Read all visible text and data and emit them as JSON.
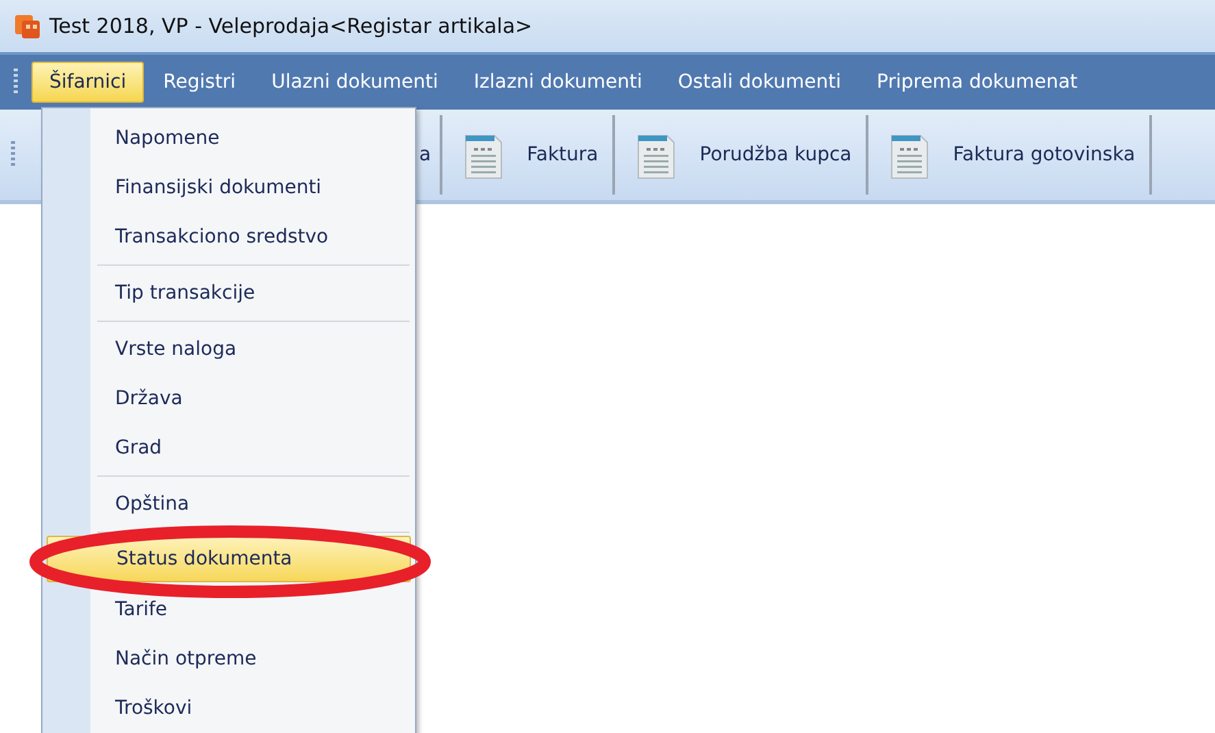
{
  "window": {
    "title": "Test 2018, VP - Veleprodaja<Registar artikala>"
  },
  "menu_bar": [
    {
      "label": "Šifarnici",
      "selected": true
    },
    {
      "label": "Registri",
      "selected": false
    },
    {
      "label": "Ulazni dokumenti",
      "selected": false
    },
    {
      "label": "Izlazni dokumenti",
      "selected": false
    },
    {
      "label": "Ostali dokumenti",
      "selected": false
    },
    {
      "label": "Priprema dokumenat",
      "selected": false
    }
  ],
  "toolbar": [
    {
      "label": "a",
      "icon": false
    },
    {
      "label": "Faktura",
      "icon": true
    },
    {
      "label": "Porudžba kupca",
      "icon": true
    },
    {
      "label": "Faktura gotovinska",
      "icon": true
    }
  ],
  "dropdown": [
    {
      "kind": "item",
      "label": "Napomene",
      "selected": false
    },
    {
      "kind": "item",
      "label": "Finansijski dokumenti",
      "selected": false
    },
    {
      "kind": "item",
      "label": "Transakciono sredstvo",
      "selected": false
    },
    {
      "kind": "separator"
    },
    {
      "kind": "item",
      "label": "Tip transakcije",
      "selected": false
    },
    {
      "kind": "separator"
    },
    {
      "kind": "item",
      "label": "Vrste naloga",
      "selected": false
    },
    {
      "kind": "item",
      "label": "Država",
      "selected": false
    },
    {
      "kind": "item",
      "label": "Grad",
      "selected": false
    },
    {
      "kind": "separator"
    },
    {
      "kind": "item",
      "label": "Opština",
      "selected": false
    },
    {
      "kind": "separator"
    },
    {
      "kind": "item",
      "label": "Status dokumenta",
      "selected": true
    },
    {
      "kind": "item",
      "label": "Tarife",
      "selected": false
    },
    {
      "kind": "item",
      "label": "Način otpreme",
      "selected": false
    },
    {
      "kind": "item",
      "label": "Troškovi",
      "selected": false
    }
  ],
  "annotation": {
    "kind": "ellipse",
    "color": "#e8202a"
  }
}
